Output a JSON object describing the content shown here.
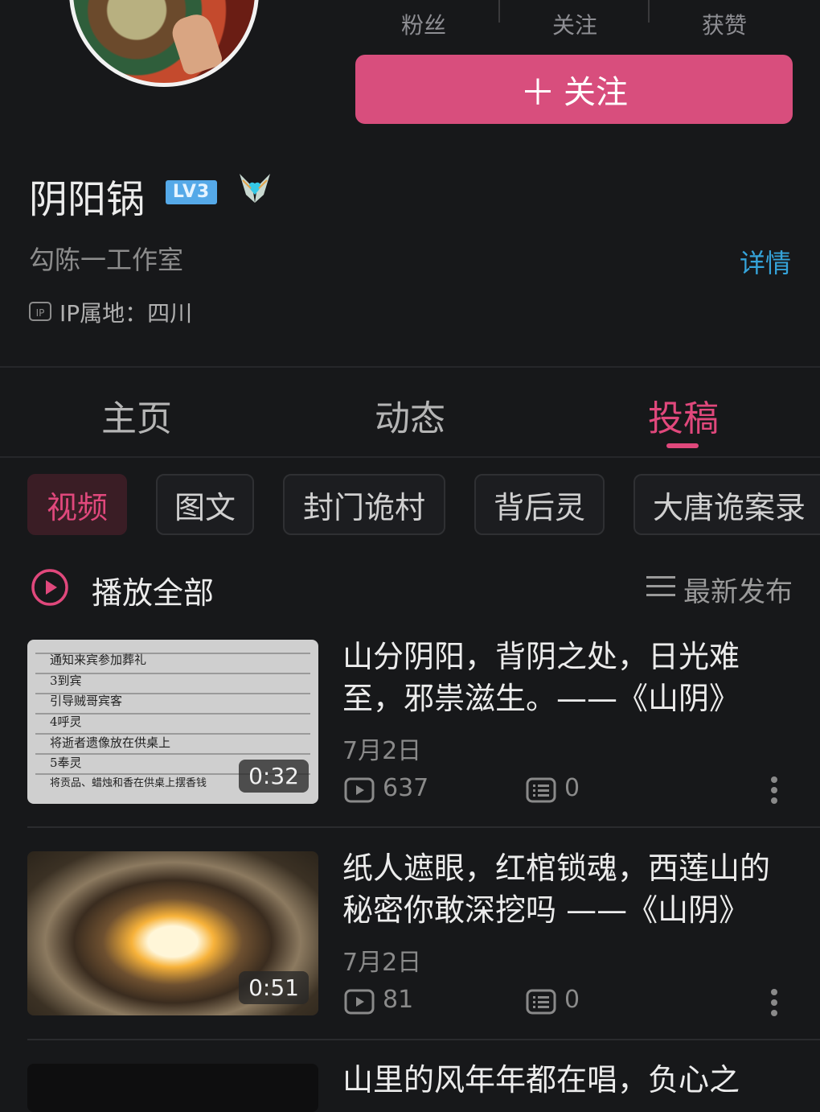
{
  "header": {
    "stats": {
      "fans_label": "粉丝",
      "following_label": "关注",
      "likes_label": "获赞"
    },
    "follow_button": {
      "icon": "plus-icon",
      "label": "关注"
    },
    "username": "阴阳锅",
    "level_badge": "LV3",
    "studio": "勾陈一工作室",
    "details_link": "详情",
    "ip_badge": "IP",
    "ip_location": "IP属地：四川"
  },
  "tabs": [
    {
      "label": "主页",
      "active": false
    },
    {
      "label": "动态",
      "active": false
    },
    {
      "label": "投稿",
      "active": true
    }
  ],
  "filter_chips": [
    {
      "label": "视频",
      "active": true
    },
    {
      "label": "图文",
      "active": false
    },
    {
      "label": "封门诡村",
      "active": false
    },
    {
      "label": "背后灵",
      "active": false
    },
    {
      "label": "大唐诡案录",
      "active": false
    }
  ],
  "play_all": {
    "icon": "play-circle-icon",
    "label": "播放全部"
  },
  "sort": {
    "icon": "list-icon",
    "label": "最新发布"
  },
  "videos": [
    {
      "thumbnail_lines": [
        "通知来宾参加葬礼",
        "3到宾",
        "引导贼哥宾客",
        "4呼灵",
        "将逝者遗像放在供桌上",
        "5奉灵",
        "将贡品、蜡烛和香在供桌上摆香钱"
      ],
      "duration": "0:32",
      "title": "山分阴阳，背阴之处，日光难至，邪祟滋生。——《山阴》",
      "date": "7月2日",
      "plays": "637",
      "comments": "0"
    },
    {
      "duration": "0:51",
      "title": "纸人遮眼，红棺锁魂，西莲山的秘密你敢深挖吗 ——《山阴》",
      "date": "7月2日",
      "plays": "81",
      "comments": "0"
    },
    {
      "title": "山里的风年年都在唱，负心之"
    }
  ],
  "colors": {
    "accent": "#d84e7d",
    "link": "#35a3d9",
    "level_badge": "#55a9e8",
    "background": "#17181a"
  }
}
